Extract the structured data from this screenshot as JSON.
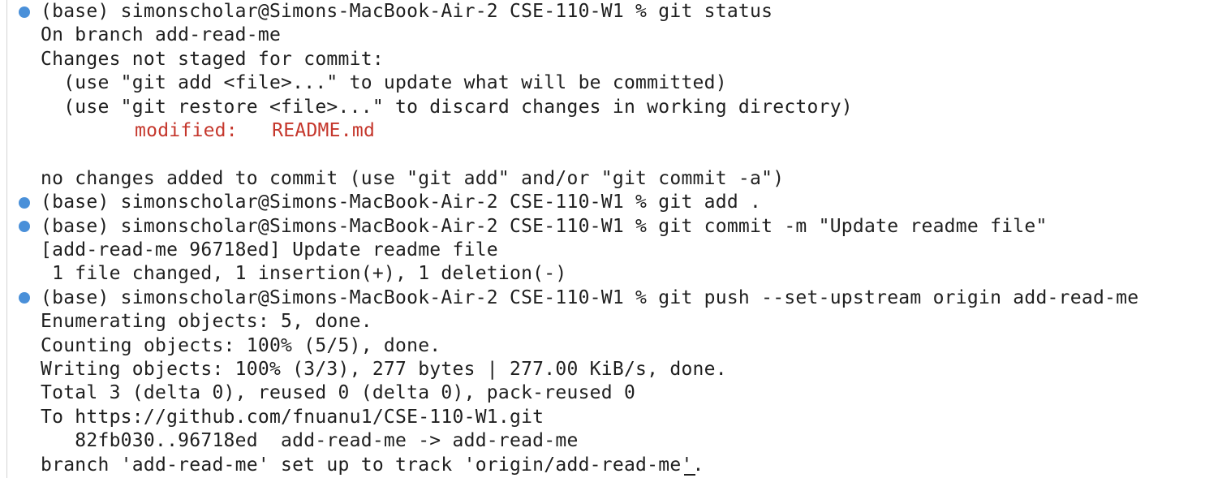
{
  "colors": {
    "background": "#ffffff",
    "text": "#1f1f1f",
    "modified": "#c5372c",
    "prompt_dot": "#4a90d9",
    "left_rule": "#d4d4d4"
  },
  "terminal": {
    "lines": [
      {
        "kind": "command",
        "prompt": "(base) simonscholar@Simons-MacBook-Air-2 CSE-110-W1 % ",
        "command": "git status"
      },
      {
        "kind": "output",
        "text": "On branch add-read-me"
      },
      {
        "kind": "output",
        "text": "Changes not staged for commit:"
      },
      {
        "kind": "output",
        "text": "  (use \"git add <file>...\" to update what will be committed)"
      },
      {
        "kind": "output",
        "text": "  (use \"git restore <file>...\" to discard changes in working directory)"
      },
      {
        "kind": "modified",
        "label": "modified:",
        "file": "README.md"
      },
      {
        "kind": "blank"
      },
      {
        "kind": "output",
        "text": "no changes added to commit (use \"git add\" and/or \"git commit -a\")"
      },
      {
        "kind": "command",
        "prompt": "(base) simonscholar@Simons-MacBook-Air-2 CSE-110-W1 % ",
        "command": "git add ."
      },
      {
        "kind": "command",
        "prompt": "(base) simonscholar@Simons-MacBook-Air-2 CSE-110-W1 % ",
        "command": "git commit -m \"Update readme file\""
      },
      {
        "kind": "output",
        "text": "[add-read-me 96718ed] Update readme file"
      },
      {
        "kind": "output",
        "text": " 1 file changed, 1 insertion(+), 1 deletion(-)"
      },
      {
        "kind": "command",
        "prompt": "(base) simonscholar@Simons-MacBook-Air-2 CSE-110-W1 % ",
        "command": "git push --set-upstream origin add-read-me"
      },
      {
        "kind": "output",
        "text": "Enumerating objects: 5, done."
      },
      {
        "kind": "output",
        "text": "Counting objects: 100% (5/5), done."
      },
      {
        "kind": "output",
        "text": "Writing objects: 100% (3/3), 277 bytes | 277.00 KiB/s, done."
      },
      {
        "kind": "output",
        "text": "Total 3 (delta 0), reused 0 (delta 0), pack-reused 0"
      },
      {
        "kind": "output",
        "text": "To https://github.com/fnuanu1/CSE-110-W1.git"
      },
      {
        "kind": "output",
        "text": "   82fb030..96718ed  add-read-me -> add-read-me"
      },
      {
        "kind": "output",
        "text": "branch 'add-read-me' set up to track 'origin/add-read-me'."
      }
    ]
  }
}
